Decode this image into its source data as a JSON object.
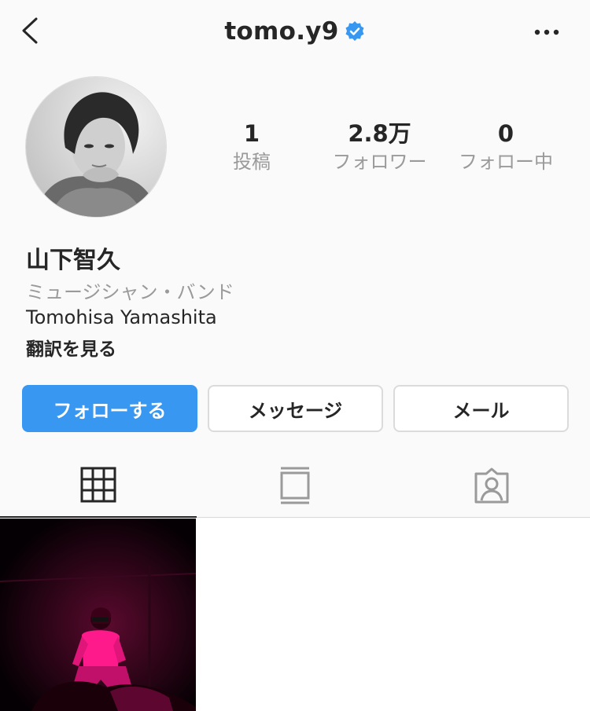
{
  "header": {
    "username": "tomo.y9",
    "verified": true,
    "back_icon": "chevron-left-icon",
    "more_icon": "more-horizontal-icon"
  },
  "profile": {
    "stats": [
      {
        "value": "1",
        "label": "投稿"
      },
      {
        "value": "2.8万",
        "label": "フォロワー"
      },
      {
        "value": "0",
        "label": "フォロー中"
      }
    ],
    "name": "山下智久",
    "category": "ミュージシャン・バンド",
    "bio": "Tomohisa Yamashita",
    "translate_label": "翻訳を見る"
  },
  "actions": {
    "follow_label": "フォローする",
    "message_label": "メッセージ",
    "email_label": "メール"
  },
  "tabs": [
    {
      "name": "grid",
      "icon": "grid-icon",
      "active": true
    },
    {
      "name": "feed",
      "icon": "feed-icon",
      "active": false
    },
    {
      "name": "tagged",
      "icon": "tagged-person-icon",
      "active": false
    }
  ],
  "colors": {
    "accent": "#3897f0",
    "text": "#262626",
    "muted": "#9a9a9a",
    "post_tint": "#ff1a8c"
  }
}
